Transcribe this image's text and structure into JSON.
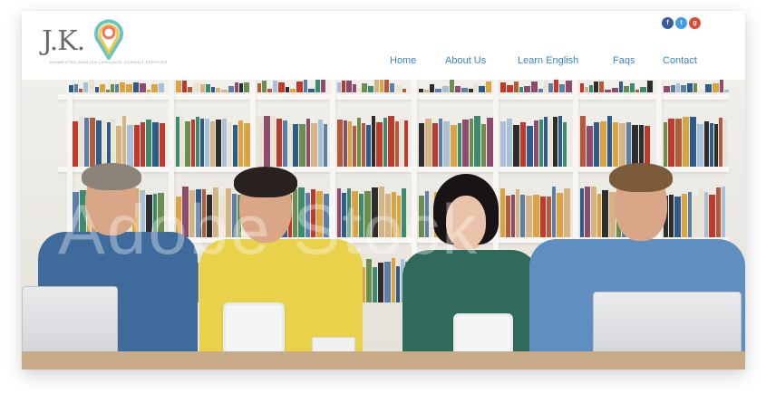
{
  "logo": {
    "mark": "J.K.",
    "tagline": "Konnected English Language Consult Services"
  },
  "social": [
    {
      "icon": "facebook-icon",
      "glyph": "f",
      "color": "#3a5b9c"
    },
    {
      "icon": "twitter-icon",
      "glyph": "t",
      "color": "#3d9fe6"
    },
    {
      "icon": "google-plus-icon",
      "glyph": "g",
      "color": "#dd4b39"
    }
  ],
  "nav": [
    {
      "label": "Home"
    },
    {
      "label": "About Us"
    },
    {
      "label": "Learn English"
    },
    {
      "label": "Faqs"
    },
    {
      "label": "Contact"
    }
  ],
  "hero": {
    "image": "people-at-laptops-in-library",
    "watermark": "Adobe Stock"
  },
  "colors": {
    "nav_link": "#3a86c0",
    "logo_gray": "#6a6a6a",
    "bulb_teal": "#6cc4c0",
    "bulb_yellow": "#f2c94c",
    "bulb_coral": "#ea7b63"
  }
}
